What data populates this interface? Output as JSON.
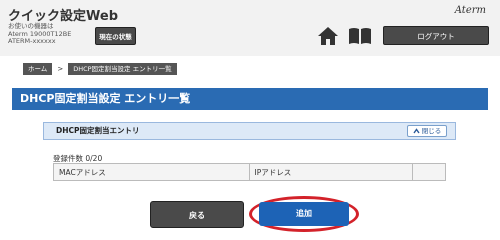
{
  "header": {
    "app_title": "クイック設定Web",
    "device_caption_label": "お使いの機器は",
    "device_model": "Aterm 19000T12BE",
    "device_name": "ATERM-xxxxxx",
    "status_button": "現在の状態",
    "brand_logo": "Aterm",
    "home_icon": "home-icon",
    "manual_icon": "book-icon",
    "logout_button": "ログアウト"
  },
  "breadcrumb": {
    "items": [
      "ホーム",
      "DHCP固定割当設定 エントリ一覧"
    ],
    "separator": ">"
  },
  "page": {
    "title": "DHCP固定割当設定 エントリ一覧",
    "accent_color": "#2a6bb3"
  },
  "section": {
    "title": "DHCP固定割当エントリ",
    "collapse_icon": "chevron-up-icon",
    "collapse_label": "閉じる"
  },
  "entries": {
    "count_label": "登録件数 0/20",
    "columns": [
      "MACアドレス",
      "IPアドレス",
      ""
    ]
  },
  "actions": {
    "back_label": "戻る",
    "add_label": "追加",
    "highlight_color": "#d3222a"
  }
}
